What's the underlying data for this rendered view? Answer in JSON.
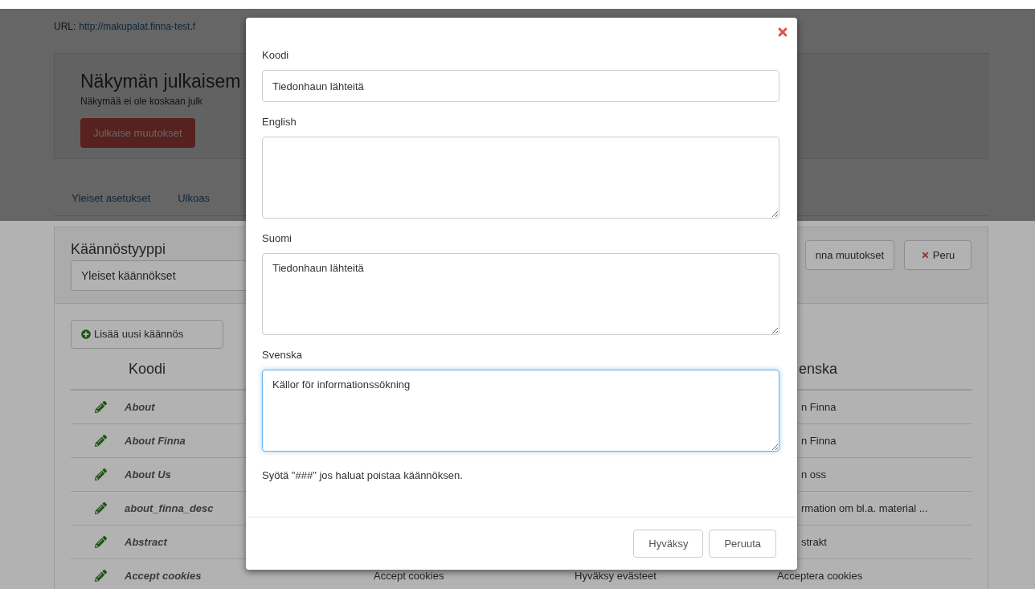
{
  "url": {
    "label": "URL:",
    "link": "http://makupalat.finna-test.f"
  },
  "publish": {
    "title": "Näkymän julkaisem",
    "note": "Näkymää ei ole koskaan julk",
    "button": "Julkaise muutokset"
  },
  "tabs": [
    {
      "label": "Yleiset asetukset",
      "selected": false
    },
    {
      "label": "Ulkoas",
      "selected": false
    }
  ],
  "translations": {
    "title": "Käännöstyyppi",
    "type_select": "Yleiset käännökset",
    "save_button": "nna muutokset",
    "cancel_button": "Peru",
    "add_button": "Lisää uusi käännös",
    "header": {
      "code": "Koodi",
      "column_4": "enska"
    },
    "rows": [
      {
        "code": "About",
        "column_4": "n Finna"
      },
      {
        "code": "About Finna",
        "column_4": "n Finna"
      },
      {
        "code": "About Us",
        "column_4": "n oss"
      },
      {
        "code": "about_finna_desc",
        "column_4": "rmation om bl.a. material ..."
      },
      {
        "code": "Abstract",
        "column_4": "strakt"
      },
      {
        "code": "Accept cookies",
        "column_2": "Accept cookies",
        "column_3": "Hyväksy evästeet",
        "column_4": "Acceptera cookies"
      }
    ]
  },
  "modal": {
    "fields": [
      {
        "label": "Koodi",
        "kind": "input",
        "value": "Tiedonhaun lähteitä",
        "focused": false
      },
      {
        "label": "English",
        "kind": "textarea",
        "focused": false
      },
      {
        "label": "Suomi",
        "kind": "textarea",
        "value": "Tiedonhaun lähteitä",
        "focused": false
      },
      {
        "label": "Svenska",
        "kind": "textarea",
        "value": "Källor för informationssökning",
        "focused": true
      }
    ],
    "help": "Syötä \"###\" jos haluat poistaa käännöksen.",
    "buttons": [
      "Hyväksy",
      "Peruuta"
    ]
  }
}
